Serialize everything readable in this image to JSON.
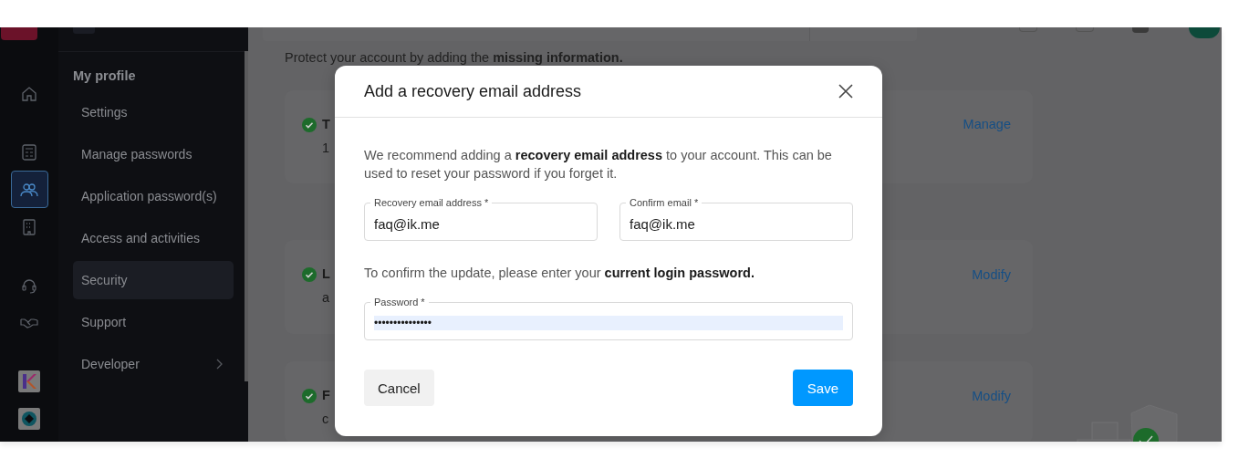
{
  "rail": {
    "items": [
      {
        "kind": "logo"
      },
      {
        "kind": "home",
        "selected": false
      },
      {
        "kind": "calculator",
        "selected": false
      },
      {
        "kind": "people",
        "selected": true
      },
      {
        "kind": "building",
        "selected": false
      },
      {
        "kind": "headset",
        "selected": false
      },
      {
        "kind": "handshake",
        "selected": false
      },
      {
        "kind": "app-k",
        "selected": false
      },
      {
        "kind": "app-disc",
        "selected": false
      }
    ]
  },
  "sidebar": {
    "heading": "My profile",
    "items": [
      {
        "label": "Settings",
        "selected": false,
        "submenu": false
      },
      {
        "label": "Manage passwords",
        "selected": false,
        "submenu": false
      },
      {
        "label": "Application password(s)",
        "selected": false,
        "submenu": false
      },
      {
        "label": "Access and activities",
        "selected": false,
        "submenu": false
      },
      {
        "label": "Security",
        "selected": true,
        "submenu": false
      },
      {
        "label": "Support",
        "selected": false,
        "submenu": false
      },
      {
        "label": "Developer",
        "selected": false,
        "submenu": true
      }
    ]
  },
  "page": {
    "notice": "Protect your account by adding the **missing information.**",
    "cards": [
      {
        "title": "T",
        "subtitle": "1",
        "action": "Manage",
        "done": true
      },
      {
        "title": "L",
        "subtitle": "a",
        "action": "Modify",
        "done": true
      },
      {
        "title": "F",
        "subtitle": "c",
        "action": "Modify",
        "done": true
      }
    ]
  },
  "dialog": {
    "title": "Add a recovery email address",
    "intro": "We recommend adding a **recovery email address** to your account. This can be used to reset your password if you forget it.",
    "fields": [
      {
        "label": "Recovery email address *",
        "value": "faq@ik.me"
      },
      {
        "label": "Confirm email *",
        "value": "faq@ik.me"
      }
    ],
    "confirm_text": "To confirm the update, please enter your **current login password.**",
    "password": {
      "label": "Password *",
      "value": "•••••••••••••••",
      "autofilled": true
    },
    "buttons": [
      {
        "label": "Cancel",
        "kind": "secondary"
      },
      {
        "label": "Save",
        "kind": "primary"
      }
    ]
  }
}
